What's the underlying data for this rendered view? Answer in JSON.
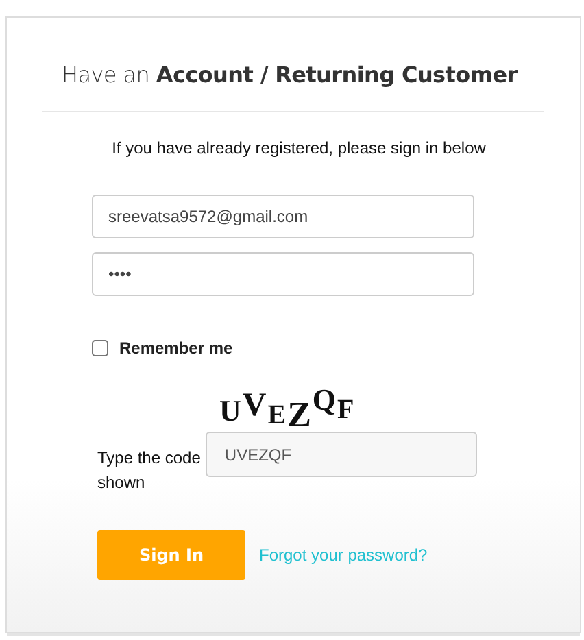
{
  "heading": {
    "prefix": "Have an",
    "emphasis": "Account / Returning Customer"
  },
  "intro": "If you have already registered, please sign in below",
  "email_field": {
    "value": "sreevatsa9572@gmail.com"
  },
  "password_field": {
    "value": "••••"
  },
  "remember": {
    "label": "Remember me",
    "checked": false
  },
  "captcha": {
    "code": "UVEZQF",
    "label": "Type the code shown",
    "value": "UVEZQF"
  },
  "sign_in_button": "Sign In",
  "forgot_link": "Forgot your password?"
}
